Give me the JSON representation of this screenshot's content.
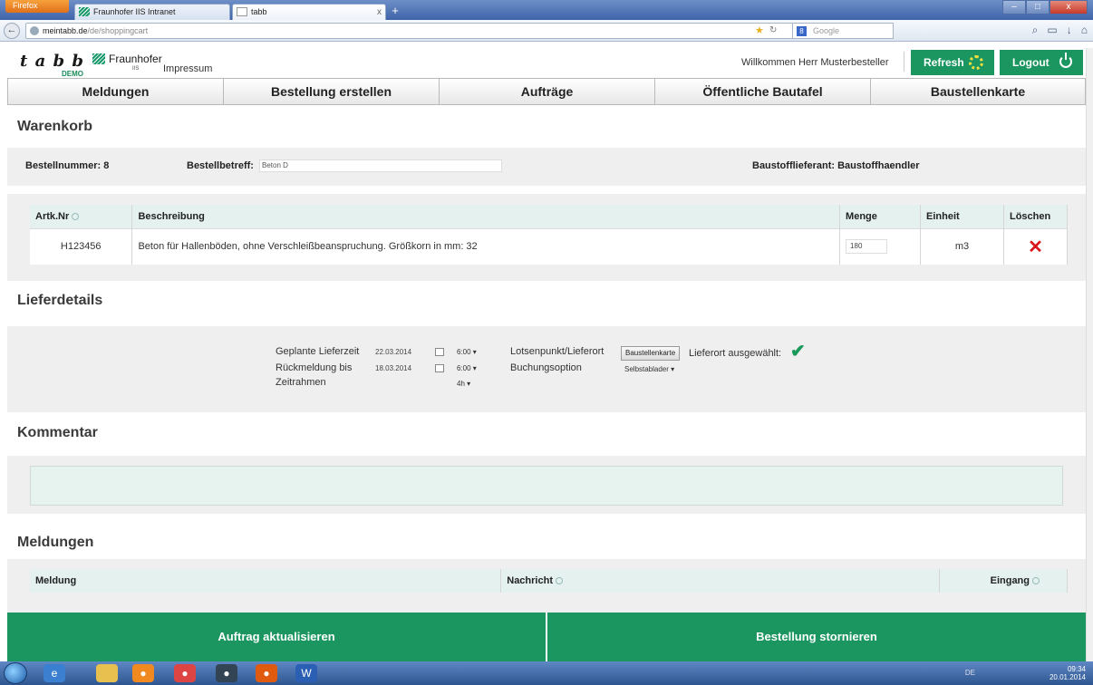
{
  "browser": {
    "menu_label": "Firefox",
    "tabs": [
      {
        "title": "Fraunhofer IIS Intranet"
      },
      {
        "title": "tabb",
        "close": "x"
      }
    ],
    "new_tab": "+",
    "url_host": "meintabb.de",
    "url_path": "/de/shoppingcart",
    "search_placeholder": "Google",
    "search_logo": "8"
  },
  "header": {
    "logo_text": "t a b b",
    "logo_demo": "DEMO",
    "fraunhofer": "Fraunhofer",
    "fraunhofer_sub": "IIS",
    "impressum": "Impressum",
    "welcome": "Willkommen Herr Musterbesteller",
    "refresh_label": "Refresh",
    "logout_label": "Logout"
  },
  "nav": [
    "Meldungen",
    "Bestellung erstellen",
    "Aufträge",
    "Öffentliche Bautafel",
    "Baustellenkarte"
  ],
  "warenkorb": {
    "title": "Warenkorb",
    "bestellnummer": "Bestellnummer: 8",
    "betreff_label": "Bestellbetreff:",
    "betreff_value": "Beton D",
    "lieferant": "Baustofflieferant: Baustoffhaendler",
    "columns": [
      "Artk.Nr",
      "Beschreibung",
      "Menge",
      "Einheit",
      "Löschen"
    ],
    "rows": [
      {
        "artnr": "H123456",
        "beschreibung": "Beton für Hallenböden, ohne Verschleißbeanspruchung. Größkorn in mm: 32",
        "menge": "180",
        "einheit": "m3"
      }
    ]
  },
  "lieferdetails": {
    "title": "Lieferdetails",
    "geplante_label": "Geplante Lieferzeit",
    "geplante_date": "22.03.2014",
    "geplante_time": "6:00",
    "rueck_label": "Rückmeldung bis",
    "rueck_date": "18.03.2014",
    "rueck_time": "6:00",
    "zeitrahmen_label": "Zeitrahmen",
    "zeitrahmen_value": "4h",
    "lotsen_label": "Lotsenpunkt/Lieferort",
    "baustellenkarte_btn": "Baustellenkarte",
    "lieferort_status": "Lieferort ausgewählt:",
    "buchung_label": "Buchungsoption",
    "buchung_value": "Selbstablader"
  },
  "kommentar": {
    "title": "Kommentar",
    "value": ""
  },
  "meldungen": {
    "title": "Meldungen",
    "columns": [
      "Meldung",
      "Nachricht",
      "Eingang"
    ]
  },
  "actions": {
    "update": "Auftrag aktualisieren",
    "cancel": "Bestellung stornieren"
  },
  "taskbar": {
    "lang": "DE",
    "time": "09:34",
    "date": "20.01.2014",
    "word_label": "W"
  },
  "colors": {
    "accent": "#1b9660",
    "delete": "#d9141b",
    "table_header": "#e4f1ee",
    "band": "#efefef"
  }
}
